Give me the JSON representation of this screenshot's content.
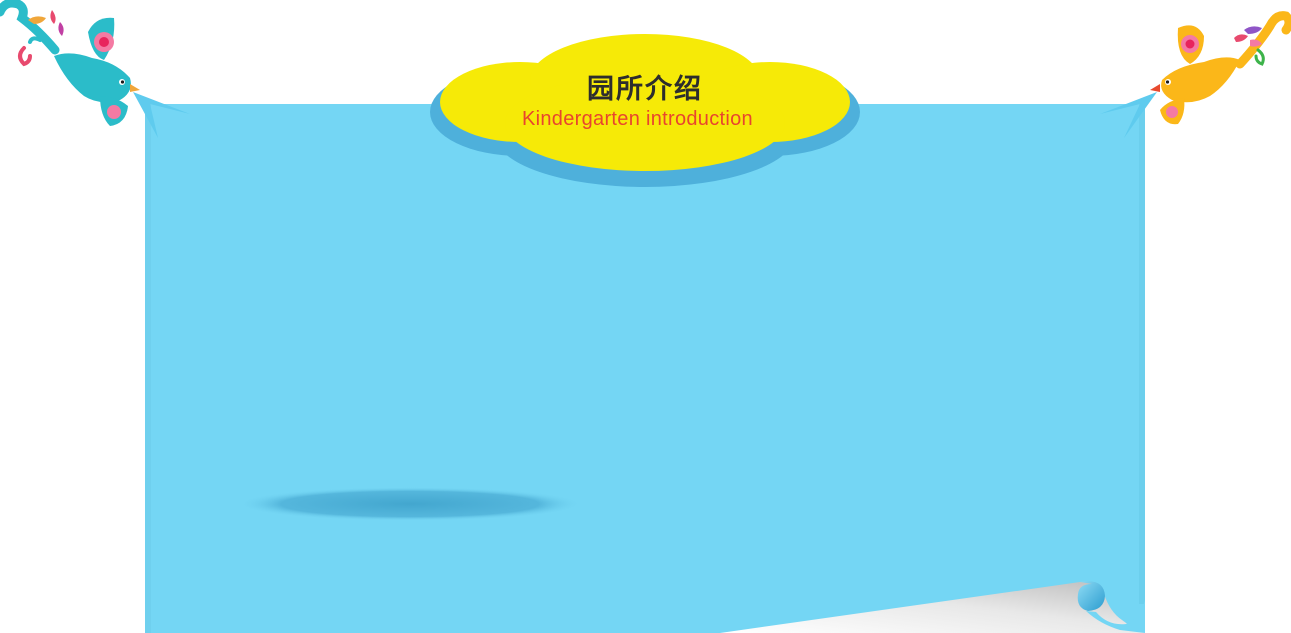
{
  "header": {
    "title_cn": "园所介绍",
    "title_en": "Kindergarten introduction"
  },
  "colors": {
    "board": "#74d6f4",
    "board_shadow": "#56b4de",
    "cloud": "#f6ea07",
    "cloud_shadow": "#4eb0db",
    "title_cn": "#2d2d2d",
    "title_en": "#e8452e",
    "bird_left": "#2bbcc9",
    "bird_right": "#fbb719"
  },
  "icons": {
    "left": "teal-bird-icon",
    "right": "orange-bird-icon"
  }
}
